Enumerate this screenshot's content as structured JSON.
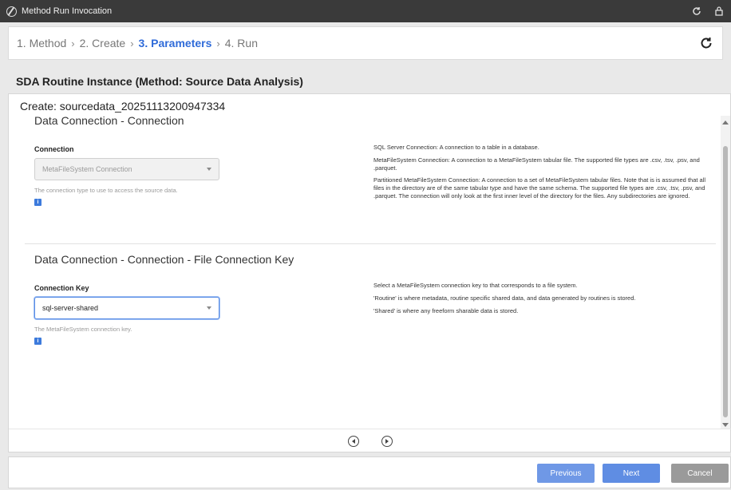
{
  "window": {
    "title": "Method Run Invocation"
  },
  "wizard": {
    "steps": [
      {
        "label": "1. Method"
      },
      {
        "label": "2. Create"
      },
      {
        "label": "3. Parameters"
      },
      {
        "label": "4. Run"
      }
    ],
    "separator": "›",
    "active_step": 2
  },
  "routine_title": "SDA Routine Instance (Method: Source Data Analysis)",
  "create_header": "Create: sourcedata_20251113200947334",
  "sections": [
    {
      "title": "Data Connection - Connection",
      "field_label": "Connection",
      "select_value": "MetaFileSystem Connection",
      "disabled": true,
      "helper": "The connection type to use to access the source data.",
      "info_glyph": "i",
      "description": [
        "SQL Server Connection: A connection to a table in a database.",
        "MetaFileSystem Connection: A connection to a MetaFileSystem tabular file. The supported file types are .csv, .tsv, .psv, and .parquet.",
        "Partitioned MetaFileSystem Connection: A connection to a set of MetaFileSystem tabular files. Note that is is assumed that all files in the directory are of the same tabular type and have the same schema. The supported file types are .csv, .tsv, .psv, and .parquet. The connection will only look at the first inner level of the directory for the files. Any subdirectories are ignored."
      ]
    },
    {
      "title": "Data Connection - Connection - File Connection Key",
      "field_label": "Connection Key",
      "select_value": "sql-server-shared",
      "disabled": false,
      "helper": "The MetaFileSystem connection key.",
      "info_glyph": "i",
      "description": [
        "Select a MetaFileSystem connection key to that corresponds to a file system.",
        "'Routine' is where metadata, routine specific shared data, and data generated by routines is stored.",
        "'Shared' is where any freeform sharable data is stored."
      ]
    }
  ],
  "footer": {
    "previous_label": "Previous",
    "next_label": "Next",
    "cancel_label": "Cancel"
  },
  "colors": {
    "accent": "#2f6bd9",
    "titlebar": "#3a3a3a",
    "primary_button": "#5f8de3",
    "cancel_button": "#9a9a9a"
  }
}
